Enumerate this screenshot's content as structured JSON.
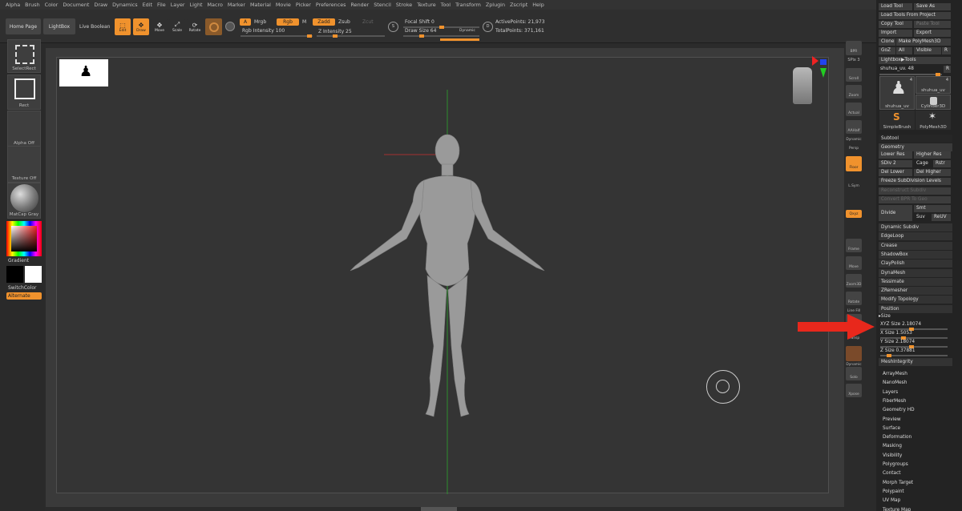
{
  "menu": [
    "Alpha",
    "Brush",
    "Color",
    "Document",
    "Draw",
    "Dynamics",
    "Edit",
    "File",
    "Layer",
    "Light",
    "Macro",
    "Marker",
    "Material",
    "Movie",
    "Picker",
    "Preferences",
    "Render",
    "Stencil",
    "Stroke",
    "Texture",
    "Tool",
    "Transform",
    "Zplugin",
    "Zscript",
    "Help"
  ],
  "top": {
    "home": "Home Page",
    "lightbox": "LightBox",
    "live_boolean": "Live Boolean",
    "edit": "Edit",
    "draw": "Draw",
    "move": "Move",
    "scale": "Scale",
    "rotate": "Rotate",
    "a": "A",
    "mrgb": "Mrgb",
    "rgb": "Rgb",
    "m": "M",
    "zadd": "Zadd",
    "zsub": "Zsub",
    "zcut": "Zcut",
    "rgb_intensity": "Rgb Intensity 100",
    "z_intensity": "Z Intensity 25",
    "focal_shift": "Focal Shift 0",
    "draw_size": "Draw Size 64",
    "dynamic": "Dynamic",
    "active_points": "ActivePoints: 21,973",
    "total_points": "TotalPoints: 371,161",
    "s": "S",
    "d": "D"
  },
  "left": {
    "select_rect": "SelectRect",
    "rect": "Rect",
    "alpha_off": "Alpha Off",
    "texture_off": "Texture Off",
    "matcap": "MatCap Gray",
    "gradient": "Gradient",
    "switch_color": "SwitchColor",
    "alternate": "Alternate"
  },
  "shelf": {
    "bpr": "BPR",
    "spix": "SPix 3",
    "scroll": "Scroll",
    "zoom": "Zoom",
    "actual": "Actual",
    "aahalf": "AAHalf",
    "dynamic": "Dynamic",
    "persp": "Persp",
    "floor": "Floor",
    "lsym": "L.Sym",
    "xyz": "Qxyz",
    "frame": "Frame",
    "move": "Move",
    "zoom3d": "Zoom3D",
    "rotate": "Rotate",
    "line_fill": "Line Fill",
    "polyf": "PolyF",
    "transp": "Transp",
    "ghost": "Ghost",
    "solo": "Solo",
    "xpose": "Xpose",
    "dynamic2": "Dynamic"
  },
  "right": {
    "load_tool": "Load Tool",
    "save_as": "Save As",
    "load_from_project": "Load Tools From Project",
    "copy_tool": "Copy Tool",
    "paste_tool": "Paste Tool",
    "import": "Import",
    "export": "Export",
    "clone": "Clone",
    "make_polymesh": "Make PolyMesh3D",
    "goz": "GoZ",
    "all": "All",
    "visible": "Visible",
    "r": "R",
    "lightbox_tools": "Lightbox▶Tools",
    "current_tool": "shuhua_uv. 48",
    "r2": "R",
    "tools": [
      {
        "name": "shuhua_uv",
        "count": "4"
      },
      {
        "name": "shuhua_uv",
        "count": "4"
      },
      {
        "name": "Cylinder3D",
        "count": ""
      },
      {
        "name": "SimpleBrush",
        "count": ""
      },
      {
        "name": "PolyMesh3D",
        "count": ""
      }
    ],
    "subtool": "Subtool",
    "geometry": "Geometry",
    "lower_res": "Lower Res",
    "higher_res": "Higher Res",
    "sdiv": "SDiv 2",
    "cage": "Cage",
    "rstr": "Rstr",
    "del_lower": "Del Lower",
    "del_higher": "Del Higher",
    "freeze": "Freeze SubDivision Levels",
    "reconstruct": "Reconstruct Subdiv",
    "convert": "Convert BPR To Geo",
    "divide": "Divide",
    "smt": "Smt",
    "suv": "Suv",
    "reuv": "ReUV",
    "geo_items": [
      "Dynamic Subdiv",
      "EdgeLoop",
      "Crease",
      "ShadowBox",
      "ClayPolish",
      "DynaMesh",
      "Tessimate",
      "ZRemesher",
      "Modify Topology",
      "Position"
    ],
    "size": "Size",
    "xyz_size": "XYZ Size 2.18074",
    "x_size": "X Size 1.5053",
    "y_size": "Y Size 2.18074",
    "z_size": "Z Size 0.37881",
    "mesh_integrity": "MeshIntegrity",
    "more": [
      "ArrayMesh",
      "NanoMesh",
      "Layers",
      "FiberMesh",
      "Geometry HD",
      "Preview",
      "Surface",
      "Deformation",
      "Masking",
      "Visibility",
      "Polygroups",
      "Contact",
      "Morph Target",
      "Polypaint",
      "UV Map",
      "Texture Map"
    ]
  },
  "colors": {
    "accent": "#f0922d",
    "arrow": "#e8281c"
  }
}
